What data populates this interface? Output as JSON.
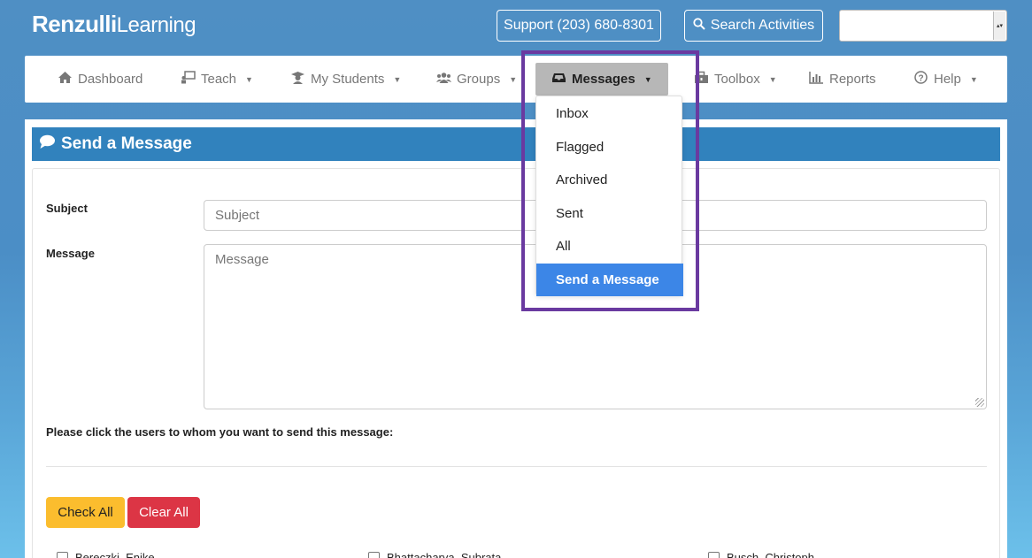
{
  "brand": {
    "part1": "Renzulli",
    "part2": "Learning"
  },
  "header": {
    "support_label": "Support (203) 680-8301",
    "search_label": "Search Activities",
    "select_value": ""
  },
  "nav": {
    "dashboard": "Dashboard",
    "teach": "Teach",
    "my_students": "My Students",
    "groups": "Groups",
    "messages": "Messages",
    "toolbox": "Toolbox",
    "reports": "Reports",
    "help": "Help"
  },
  "messages_menu": {
    "items": [
      "Inbox",
      "Flagged",
      "Archived",
      "Sent",
      "All",
      "Send a Message"
    ],
    "selected": "Send a Message"
  },
  "page": {
    "title": "Send a Message",
    "subject_label": "Subject",
    "subject_placeholder": "Subject",
    "message_label": "Message",
    "message_placeholder": "Message",
    "instructions": "Please click the users to whom you want to send this message:",
    "check_all": "Check All",
    "clear_all": "Clear All",
    "users": [
      "Bereczki, Enike",
      "Bhattacharya, Subrata",
      "Busch, Christoph"
    ]
  },
  "colors": {
    "header_bar": "#3182bd",
    "highlight": "#6a3aa0",
    "selected_item": "#3c86e7",
    "check_all": "#fbbd2e",
    "clear_all": "#dc3545"
  }
}
